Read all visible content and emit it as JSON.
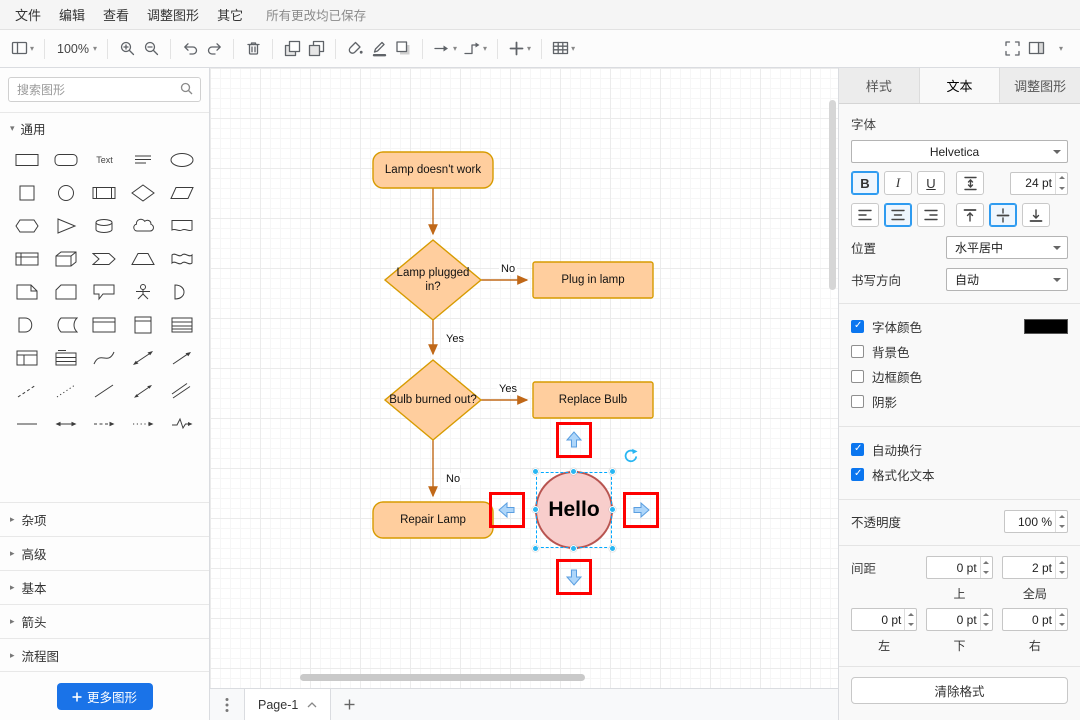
{
  "menu": {
    "items": [
      "文件",
      "编辑",
      "查看",
      "调整图形",
      "其它"
    ],
    "status": "所有更改均已保存"
  },
  "toolbar": {
    "zoom": "100%"
  },
  "sidebar": {
    "search_placeholder": "搜索图形",
    "general_label": "通用",
    "sections": [
      "杂项",
      "高级",
      "基本",
      "箭头",
      "流程图"
    ],
    "more_shapes_label": "更多图形",
    "text_shape_label": "Text"
  },
  "canvas": {
    "nodes": {
      "start": "Lamp doesn't work",
      "decision1": "Lamp plugged in?",
      "action1": "Plug in lamp",
      "decision2": "Bulb burned out?",
      "action2": "Replace Bulb",
      "action3": "Repair Lamp",
      "selected": "Hello"
    },
    "edge_labels": {
      "no1": "No",
      "yes1": "Yes",
      "yes2": "Yes",
      "no2": "No"
    },
    "colors": {
      "node_fill": "#ffce9e",
      "node_stroke": "#d79b00",
      "selected_fill": "#f8cecc",
      "selected_stroke": "#b85450",
      "edge": "#c06818",
      "selection": "#29b6f2",
      "annotation": "#fe0000"
    }
  },
  "footer": {
    "page_label": "Page-1"
  },
  "panel": {
    "tabs": [
      {
        "label": "样式",
        "active": false
      },
      {
        "label": "文本",
        "active": true
      },
      {
        "label": "调整图形",
        "active": false
      }
    ],
    "font_section_label": "字体",
    "font_family": "Helvetica",
    "bold_label": "B",
    "italic_label": "I",
    "underline_label": "U",
    "font_size": "24 pt",
    "bold_active": true,
    "halign_center_active": true,
    "valign_middle_active": true,
    "position_label": "位置",
    "position_value": "水平居中",
    "direction_label": "书写方向",
    "direction_value": "自动",
    "font_color": {
      "label": "字体颜色",
      "checked": true,
      "swatch": "#000000"
    },
    "background_color": {
      "label": "背景色",
      "checked": false
    },
    "border_color": {
      "label": "边框颜色",
      "checked": false
    },
    "shadow": {
      "label": "阴影",
      "checked": false
    },
    "word_wrap": {
      "label": "自动换行",
      "checked": true
    },
    "formatted_text": {
      "label": "格式化文本",
      "checked": true
    },
    "opacity_label": "不透明度",
    "opacity_value": "100 %",
    "spacing_label": "间距",
    "spacing": {
      "top": "0 pt",
      "top_label": "上",
      "global": "2 pt",
      "global_label": "全局",
      "left": "0 pt",
      "left_label": "左",
      "bottom": "0 pt",
      "bottom_label": "下",
      "right": "0 pt",
      "right_label": "右"
    },
    "clear_label": "清除格式"
  }
}
